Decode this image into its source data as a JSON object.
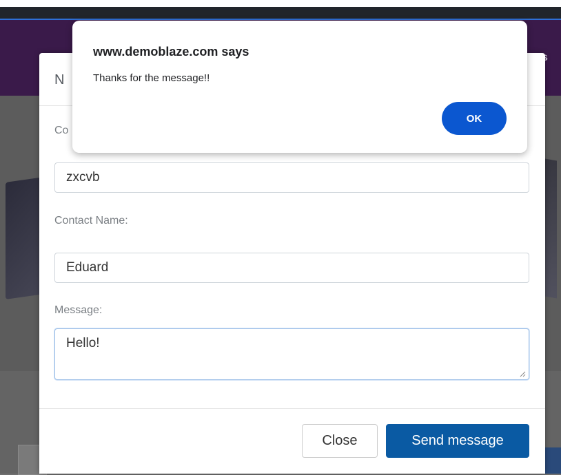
{
  "background": {
    "nav_fragment": "s"
  },
  "modal": {
    "title": "N",
    "fields": {
      "email_label": "Co",
      "email_value": "zxcvb",
      "name_label": "Contact Name:",
      "name_value": "Eduard",
      "message_label": "Message:",
      "message_value": "Hello!"
    },
    "buttons": {
      "close": "Close",
      "send": "Send message"
    }
  },
  "alert": {
    "title": "www.demoblaze.com says",
    "message": "Thanks for the message!!",
    "ok": "OK"
  },
  "colors": {
    "primary_button": "#0a5aa3",
    "alert_button": "#0b57d0",
    "nav_background": "#3a1a4a"
  }
}
